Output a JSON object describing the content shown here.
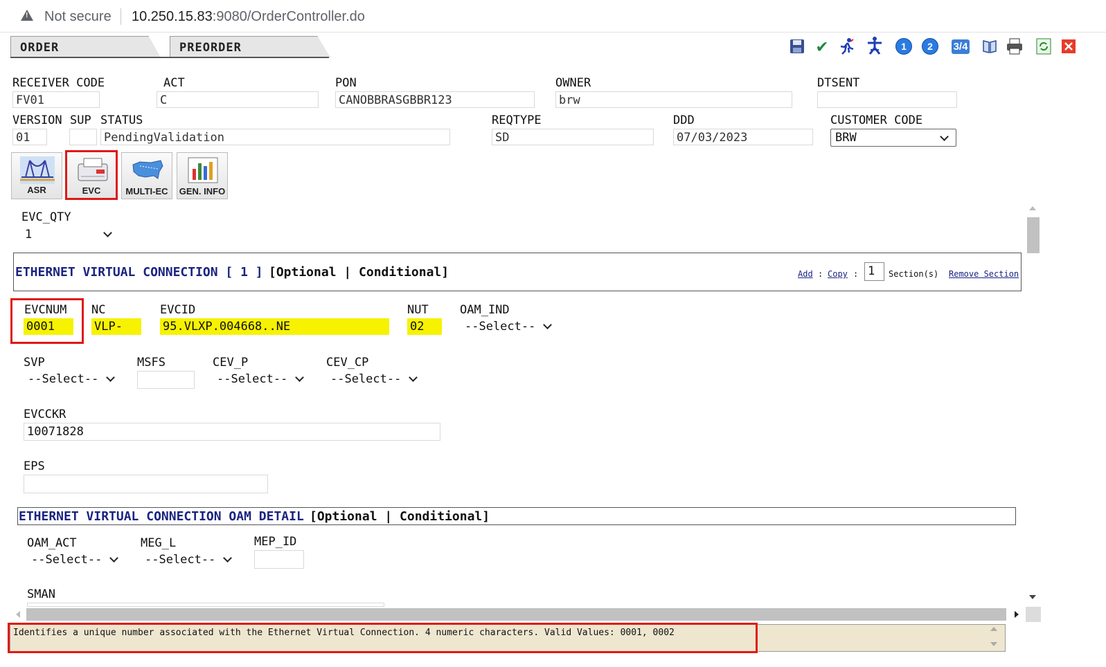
{
  "browser": {
    "security_label": "Not secure",
    "url_host": "10.250.15.83",
    "url_rest": ":9080/OrderController.do"
  },
  "tabs": [
    {
      "label": "ORDER"
    },
    {
      "label": "PREORDER"
    }
  ],
  "toolbar": {
    "icons": [
      "save-icon",
      "check-icon",
      "runner-icon",
      "runner-alt-icon",
      "one-icon",
      "two-icon",
      "three-four-icon",
      "book-icon",
      "print-icon",
      "refresh-icon",
      "close-icon"
    ],
    "btn1": "1",
    "btn2": "2",
    "btn34": "3/4"
  },
  "header": {
    "receiver_code": {
      "label": "RECEIVER CODE",
      "value": "FV01"
    },
    "act": {
      "label": "ACT",
      "value": "C"
    },
    "pon": {
      "label": "PON",
      "value": "CANOBBRASGBBR123"
    },
    "owner": {
      "label": "OWNER",
      "value": "brw"
    },
    "dtsent": {
      "label": "DTSENT",
      "value": ""
    },
    "version": {
      "label": "VERSION",
      "value": "01"
    },
    "sup": {
      "label": "SUP",
      "value": ""
    },
    "status": {
      "label": "STATUS",
      "value": "PendingValidation"
    },
    "reqtype": {
      "label": "REQTYPE",
      "value": "SD"
    },
    "ddd": {
      "label": "DDD",
      "value": "07/03/2023"
    },
    "customer_code": {
      "label": "CUSTOMER CODE",
      "value": "BRW"
    }
  },
  "forms": [
    {
      "label": "ASR"
    },
    {
      "label": "EVC"
    },
    {
      "label": "MULTI-EC"
    },
    {
      "label": "GEN. INFO"
    }
  ],
  "evc_qty": {
    "label": "EVC_QTY",
    "value": "1"
  },
  "evc_section": {
    "title": "ETHERNET VIRTUAL CONNECTION [ 1 ]",
    "opt": "[Optional | Conditional]",
    "add": "Add ",
    "colon1": ":",
    "copy": "Copy ",
    "colon2": ":",
    "copy_count": "1",
    "sections": "Section(s)",
    "remove": "Remove Section"
  },
  "evc_fields": {
    "evcnum": {
      "label": "EVCNUM",
      "value": "0001"
    },
    "nc": {
      "label": "NC",
      "value": "VLP-"
    },
    "evcid": {
      "label": "EVCID",
      "value": "95.VLXP.004668..NE"
    },
    "nut": {
      "label": "NUT",
      "value": "02"
    },
    "oam_ind": {
      "label": "OAM_IND",
      "value": "--Select--"
    },
    "svp": {
      "label": "SVP",
      "value": "--Select--"
    },
    "msfs": {
      "label": "MSFS",
      "value": ""
    },
    "cev_p": {
      "label": "CEV_P",
      "value": "--Select--"
    },
    "cev_cp": {
      "label": "CEV_CP",
      "value": "--Select--"
    },
    "evcckr": {
      "label": "EVCCKR",
      "value": "10071828"
    },
    "eps": {
      "label": "EPS",
      "value": ""
    }
  },
  "oam_section": {
    "title": "ETHERNET VIRTUAL CONNECTION OAM DETAIL",
    "opt": "[Optional | Conditional]"
  },
  "oam_fields": {
    "oam_act": {
      "label": "OAM_ACT",
      "value": "--Select--"
    },
    "meg_l": {
      "label": "MEG_L",
      "value": "--Select--"
    },
    "mep_id": {
      "label": "MEP_ID",
      "value": ""
    },
    "sman": {
      "label": "SMAN",
      "value": ""
    }
  },
  "description": "Identifies a unique number associated with the Ethernet Virtual Connection. 4 numeric characters. Valid Values: 0001, 0002",
  "colors": {
    "highlight": "#f7f200",
    "focus_outline": "#e01818",
    "section_title": "#1a2480",
    "desc_bg": "#eee6cf"
  }
}
